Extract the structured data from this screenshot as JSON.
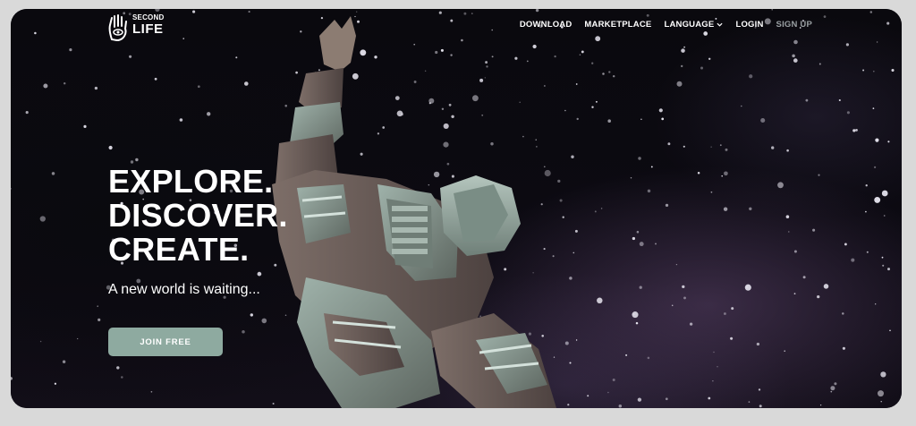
{
  "brand": {
    "logo_top": "SECOND",
    "logo_bottom": "LIFE",
    "logo_icon": "hand-eye-icon"
  },
  "nav": {
    "items": [
      {
        "label": "DOWNLOAD"
      },
      {
        "label": "MARKETPLACE"
      },
      {
        "label": "LANGUAGE",
        "icon": "chevron-down-icon"
      },
      {
        "label": "LOGIN"
      },
      {
        "label": "SIGN UP"
      }
    ]
  },
  "hero": {
    "headline": [
      "EXPLORE.",
      "DISCOVER.",
      "CREATE."
    ],
    "subhead": "A new world is waiting...",
    "cta_label": "JOIN FREE"
  },
  "colors": {
    "background": "#08070c",
    "cta": "#8eaaa0",
    "text": "#ffffff",
    "nav_muted": "#9aa0a3",
    "page_outer": "#d9d9d9"
  }
}
